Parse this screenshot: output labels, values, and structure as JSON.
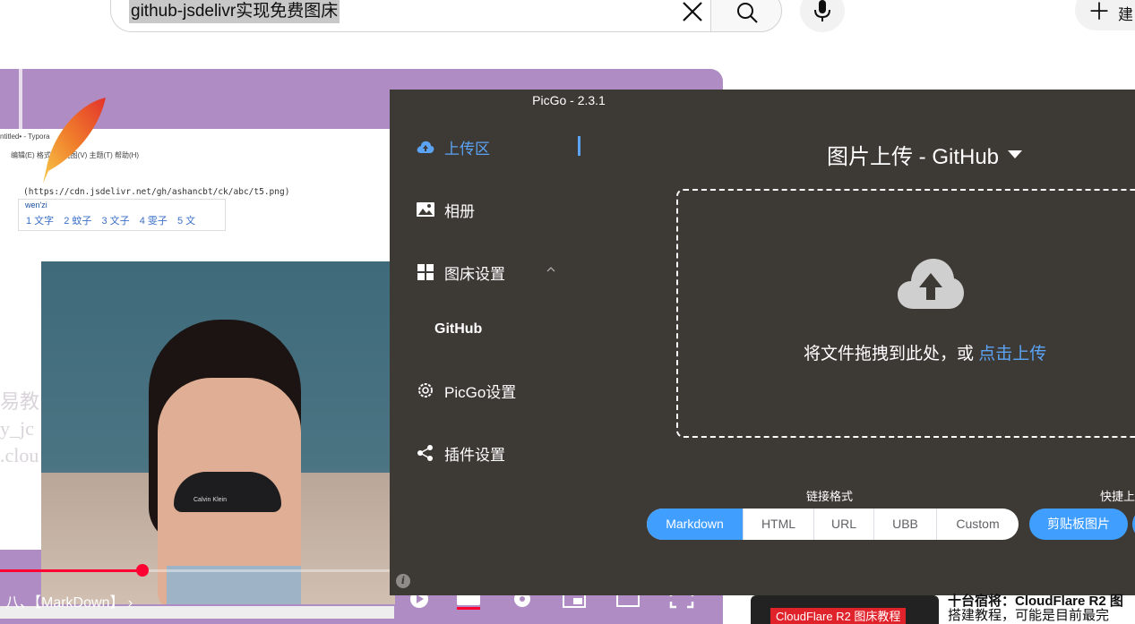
{
  "youtube": {
    "search_query": "github-jsdelivr实现免费图床",
    "create_label": "建"
  },
  "video": {
    "typora_title": "ntitled• - Typora",
    "typora_menu": "编辑(E)      格式(O)   视图(V)   主题(T)   帮助(H)",
    "code_line": "(https://cdn.jsdelivr.net/gh/ashancbt/ck/abc/t5.png)",
    "ime_input": "wen'zi",
    "ime_candidates": [
      "1 文字",
      "2 蚊子",
      "3 文子",
      "4 雯子",
      "5 文"
    ],
    "photo_text": "Calvin Klein",
    "watermark_lines": [
      "易教",
      "y_jc",
      ".clou"
    ],
    "chapter_title": "八、【MarkDown】",
    "progress": 0.36
  },
  "picgo": {
    "window_title": "PicGo - 2.3.1",
    "nav": {
      "upload": "上传区",
      "album": "相册",
      "bed_settings": "图床设置",
      "github": "GitHub",
      "picgo_settings": "PicGo设置",
      "plugins": "插件设置"
    },
    "main_title": "图片上传 - GitHub",
    "drop_text": "将文件拖拽到此处，或 ",
    "drop_link": "点击上传",
    "link_format_label": "链接格式",
    "quick_label": "快捷上",
    "formats": [
      "Markdown",
      "HTML",
      "URL",
      "UBB",
      "Custom"
    ],
    "selected_format": "Markdown",
    "clipboard_button": "剪贴板图片",
    "colors": {
      "accent": "#409eff",
      "bg": "#3d3935"
    }
  },
  "recommendation": {
    "badge": "CloudFlare R2 图床教程",
    "line1": "十台宿将：CloudFlare R2 图",
    "line2": "搭建教程，可能是目前最完"
  }
}
